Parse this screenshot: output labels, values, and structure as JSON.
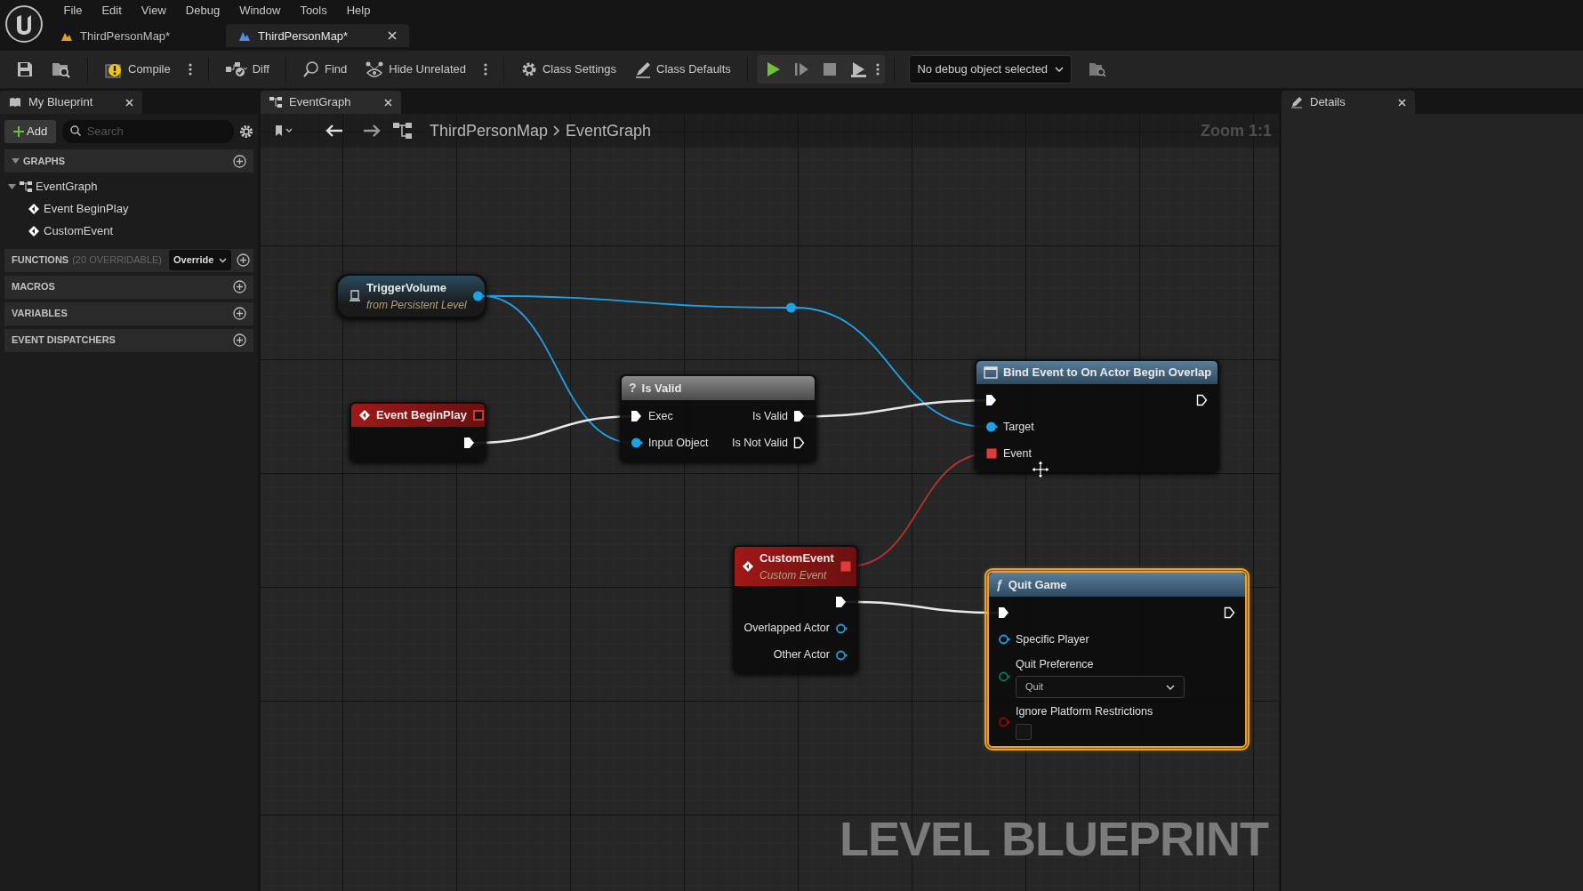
{
  "menu": [
    "File",
    "Edit",
    "View",
    "Debug",
    "Window",
    "Tools",
    "Help"
  ],
  "document_tabs": [
    {
      "label": "ThirdPersonMap*",
      "kind": "level",
      "selected": false
    },
    {
      "label": "ThirdPersonMap*",
      "kind": "blueprint",
      "selected": true
    }
  ],
  "toolbar": {
    "compile": "Compile",
    "diff": "Diff",
    "find": "Find",
    "hide_unrelated": "Hide Unrelated",
    "class_settings": "Class Settings",
    "class_defaults": "Class Defaults",
    "debug_object": "No debug object selected"
  },
  "my_blueprint": {
    "tab": "My Blueprint",
    "add": "Add",
    "search": {
      "placeholder": "Search"
    },
    "sections": [
      {
        "title": "GRAPHS",
        "expanded": true,
        "items": [
          {
            "label": "EventGraph",
            "expanded": true,
            "children": [
              {
                "label": "Event BeginPlay"
              },
              {
                "label": "CustomEvent"
              }
            ]
          }
        ]
      },
      {
        "title": "FUNCTIONS",
        "note": "(20 OVERRIDABLE)",
        "override": "Override",
        "expanded": false
      },
      {
        "title": "MACROS",
        "expanded": false
      },
      {
        "title": "VARIABLES",
        "expanded": false
      },
      {
        "title": "EVENT DISPATCHERS",
        "expanded": false
      }
    ]
  },
  "graph": {
    "tab": "EventGraph",
    "breadcrumb": [
      "ThirdPersonMap",
      "EventGraph"
    ],
    "zoom": "Zoom 1:1",
    "graph_type": "LEVEL BLUEPRINT",
    "nodes": [
      {
        "kind": "reference",
        "title": "TriggerVolume",
        "subtitle": "from Persistent Level",
        "selected": false,
        "header_pin": {
          "kind": "object",
          "connected": true
        }
      },
      {
        "kind": "event",
        "title": "Event BeginPlay",
        "selected": false,
        "header_pin": {
          "kind": "delegate",
          "connected": false
        },
        "rows": [
          {
            "out": {
              "kind": "exec",
              "connected": true
            }
          }
        ]
      },
      {
        "kind": "macro",
        "glyph": "?",
        "title": "Is Valid",
        "selected": false,
        "rows": [
          {
            "in": {
              "kind": "exec",
              "label": "Exec",
              "connected": true
            },
            "out": {
              "kind": "exec",
              "label": "Is Valid",
              "connected": true
            }
          },
          {
            "in": {
              "kind": "object",
              "label": "Input Object",
              "connected": true
            },
            "out": {
              "kind": "exec",
              "label": "Is Not Valid",
              "connected": false
            }
          }
        ]
      },
      {
        "kind": "function",
        "title": "Bind Event to On Actor Begin Overlap",
        "selected": false,
        "rows": [
          {
            "in": {
              "kind": "exec",
              "connected": true
            },
            "out": {
              "kind": "exec",
              "connected": false
            }
          },
          {
            "in": {
              "kind": "object",
              "label": "Target",
              "connected": true
            }
          },
          {
            "in": {
              "kind": "delegate",
              "label": "Event",
              "connected": true
            }
          }
        ]
      },
      {
        "kind": "event",
        "title": "CustomEvent",
        "subtitle": "Custom Event",
        "selected": false,
        "header_pin": {
          "kind": "delegate",
          "connected": true
        },
        "rows": [
          {
            "out": {
              "kind": "exec",
              "connected": true
            }
          },
          {
            "out": {
              "kind": "object",
              "label": "Overlapped Actor",
              "connected": false
            }
          },
          {
            "out": {
              "kind": "object",
              "label": "Other Actor",
              "connected": false
            }
          }
        ]
      },
      {
        "kind": "function",
        "glyph": "ƒ",
        "title": "Quit Game",
        "selected": true,
        "rows": [
          {
            "in": {
              "kind": "exec",
              "connected": true
            },
            "out": {
              "kind": "exec",
              "connected": false
            }
          },
          {
            "in": {
              "kind": "object",
              "label": "Specific Player",
              "connected": false
            }
          },
          {
            "in": {
              "kind": "enum",
              "label": "Quit Preference",
              "connected": false,
              "value": {
                "kind": "dropdown",
                "text": "Quit"
              }
            }
          },
          {
            "in": {
              "kind": "bool",
              "label": "Ignore Platform Restrictions",
              "connected": false,
              "value": {
                "kind": "checkbox",
                "checked": false
              }
            }
          }
        ]
      },
      {
        "kind": "reroute",
        "header_pin": {
          "kind": "object",
          "connected": true
        }
      }
    ]
  },
  "details": {
    "tab": "Details"
  }
}
